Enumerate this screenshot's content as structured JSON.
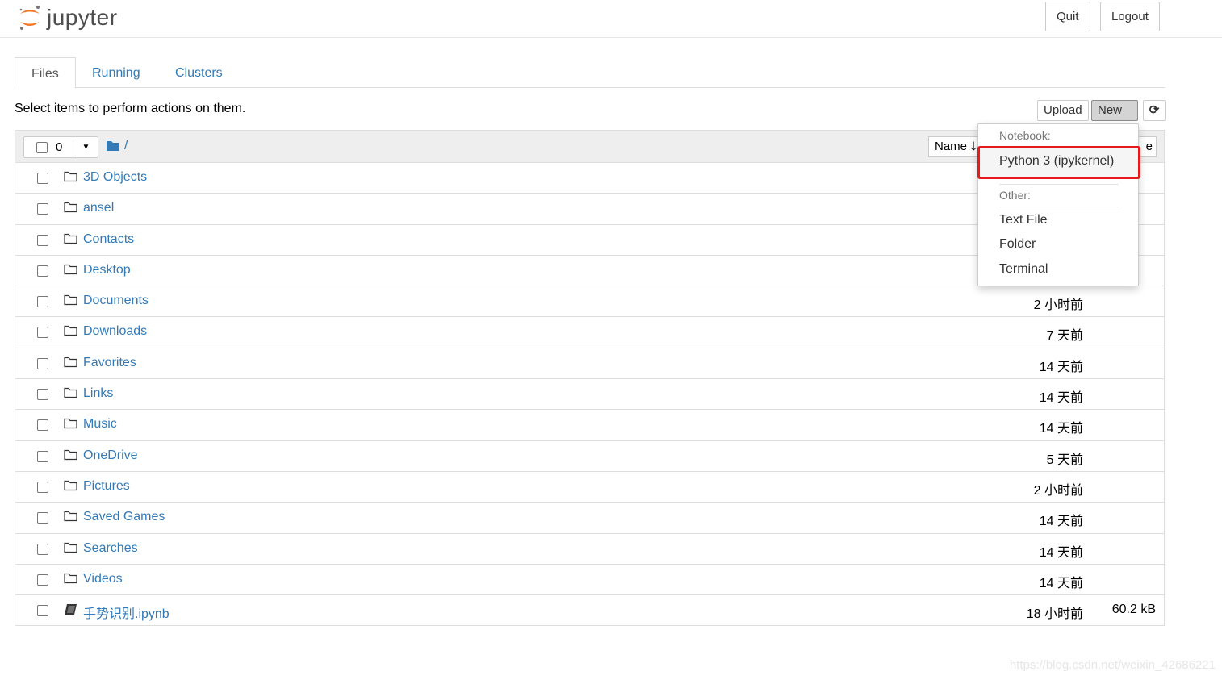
{
  "header": {
    "logo_text": "jupyter",
    "quit": "Quit",
    "logout": "Logout"
  },
  "tabs": [
    {
      "label": "Files",
      "active": true
    },
    {
      "label": "Running"
    },
    {
      "label": "Clusters"
    }
  ],
  "hint": "Select items to perform actions on them.",
  "toolbar": {
    "upload": "Upload",
    "new": "New"
  },
  "list_header": {
    "selected_count": "0",
    "path": "/",
    "name_sort": "Name",
    "size_sort": "e"
  },
  "rows": [
    {
      "name": "3D Objects",
      "type": "folder",
      "modified": "",
      "size": ""
    },
    {
      "name": "ansel",
      "type": "folder",
      "modified": "",
      "size": ""
    },
    {
      "name": "Contacts",
      "type": "folder",
      "modified": "",
      "size": ""
    },
    {
      "name": "Desktop",
      "type": "folder",
      "modified": "",
      "size": ""
    },
    {
      "name": "Documents",
      "type": "folder",
      "modified": "2 小时前",
      "size": ""
    },
    {
      "name": "Downloads",
      "type": "folder",
      "modified": "7 天前",
      "size": ""
    },
    {
      "name": "Favorites",
      "type": "folder",
      "modified": "14 天前",
      "size": ""
    },
    {
      "name": "Links",
      "type": "folder",
      "modified": "14 天前",
      "size": ""
    },
    {
      "name": "Music",
      "type": "folder",
      "modified": "14 天前",
      "size": ""
    },
    {
      "name": "OneDrive",
      "type": "folder",
      "modified": "5 天前",
      "size": ""
    },
    {
      "name": "Pictures",
      "type": "folder",
      "modified": "2 小时前",
      "size": ""
    },
    {
      "name": "Saved Games",
      "type": "folder",
      "modified": "14 天前",
      "size": ""
    },
    {
      "name": "Searches",
      "type": "folder",
      "modified": "14 天前",
      "size": ""
    },
    {
      "name": "Videos",
      "type": "folder",
      "modified": "14 天前",
      "size": ""
    },
    {
      "name": "手势识别.ipynb",
      "type": "notebook",
      "modified": "18 小时前",
      "size": "60.2 kB"
    }
  ],
  "new_menu": {
    "notebook_header": "Notebook:",
    "python": "Python 3 (ipykernel)",
    "other_header": "Other:",
    "text_file": "Text File",
    "folder": "Folder",
    "terminal": "Terminal"
  },
  "watermark": "https://blog.csdn.net/weixin_42686221",
  "colors": {
    "link": "#337ab7",
    "highlight": "#e8191a",
    "logo_orange": "#f37726"
  }
}
